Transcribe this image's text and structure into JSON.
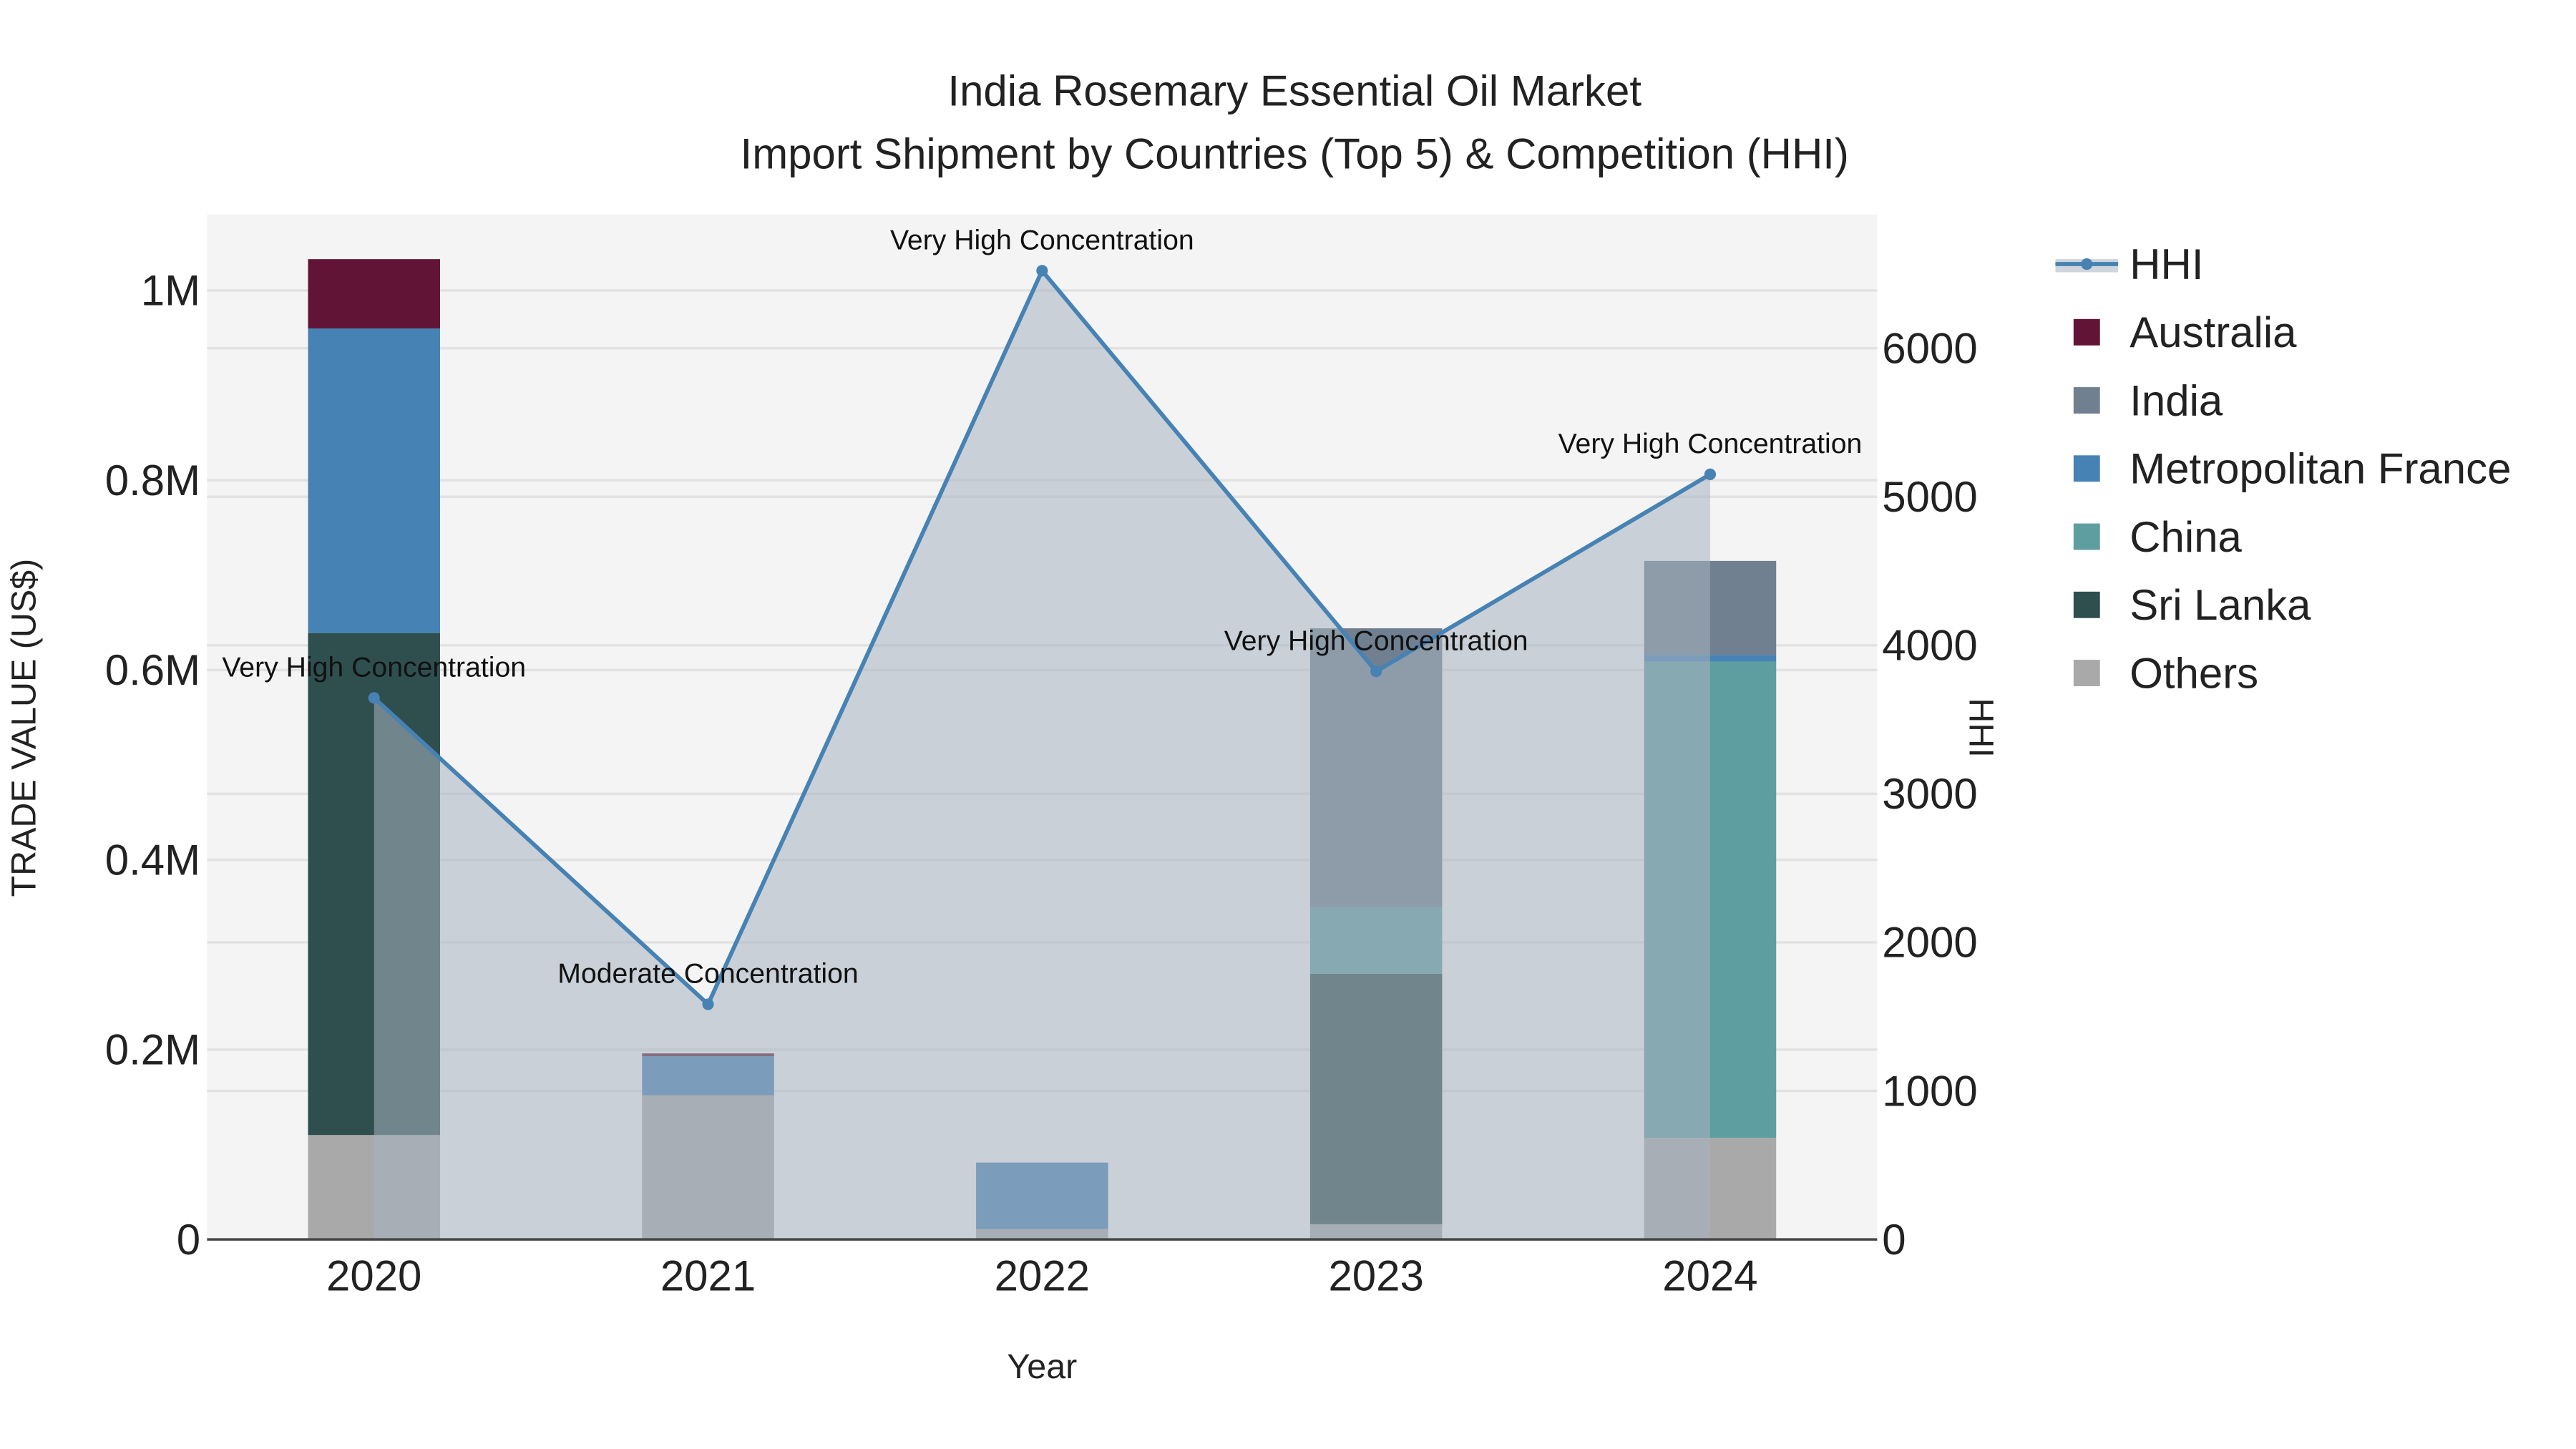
{
  "chart_data": {
    "type": "bar",
    "title": "India Rosemary Essential Oil Market",
    "subtitle": "Import Shipment by Countries (Top 5) & Competition (HHI)",
    "xlabel": "Year",
    "ylabel": "TRADE VALUE (US$)",
    "y2label": "HHI",
    "categories": [
      "2020",
      "2021",
      "2022",
      "2023",
      "2024"
    ],
    "ylim": [
      0,
      1080000
    ],
    "y2lim": [
      0,
      6900
    ],
    "yticks": [
      {
        "v": 0,
        "label": "0"
      },
      {
        "v": 200000,
        "label": "0.2M"
      },
      {
        "v": 400000,
        "label": "0.4M"
      },
      {
        "v": 600000,
        "label": "0.6M"
      },
      {
        "v": 800000,
        "label": "0.8M"
      },
      {
        "v": 1000000,
        "label": "1M"
      }
    ],
    "y2ticks": [
      {
        "v": 0,
        "label": "0"
      },
      {
        "v": 1000,
        "label": "1000"
      },
      {
        "v": 2000,
        "label": "2000"
      },
      {
        "v": 3000,
        "label": "3000"
      },
      {
        "v": 4000,
        "label": "4000"
      },
      {
        "v": 5000,
        "label": "5000"
      },
      {
        "v": 6000,
        "label": "6000"
      }
    ],
    "stacked": true,
    "series": [
      {
        "name": "Others",
        "color": "#A9A9A9",
        "values": [
          110000,
          152000,
          11000,
          16000,
          107000
        ]
      },
      {
        "name": "Sri Lanka",
        "color": "#2F4F4F",
        "values": [
          529000,
          0,
          0,
          264000,
          0
        ]
      },
      {
        "name": "China",
        "color": "#5F9EA0",
        "values": [
          0,
          0,
          0,
          70000,
          502000
        ]
      },
      {
        "name": "Metropolitan France",
        "color": "#4682B4",
        "values": [
          321000,
          41000,
          70000,
          0,
          7000
        ]
      },
      {
        "name": "India",
        "color": "#708090",
        "values": [
          0,
          0,
          0,
          294000,
          99000
        ]
      },
      {
        "name": "Australia",
        "color": "#621436",
        "values": [
          73000,
          3000,
          0,
          0,
          0
        ]
      }
    ],
    "hhi": {
      "name": "HHI",
      "color": "#4682B4",
      "values": [
        3646,
        1583,
        6522,
        3824,
        5151
      ],
      "annotations": [
        "Very High Concentration",
        "Moderate Concentration",
        "Very High Concentration",
        "Very High Concentration",
        "Very High Concentration"
      ]
    },
    "legend": {
      "placement": "right",
      "items": [
        {
          "name": "HHI",
          "color": "#4682B4",
          "kind": "line"
        },
        {
          "name": "Australia",
          "color": "#621436"
        },
        {
          "name": "India",
          "color": "#708090"
        },
        {
          "name": "Metropolitan France",
          "color": "#4682B4"
        },
        {
          "name": "China",
          "color": "#5F9EA0"
        },
        {
          "name": "Sri Lanka",
          "color": "#2F4F4F"
        },
        {
          "name": "Others",
          "color": "#A9A9A9"
        }
      ]
    }
  }
}
